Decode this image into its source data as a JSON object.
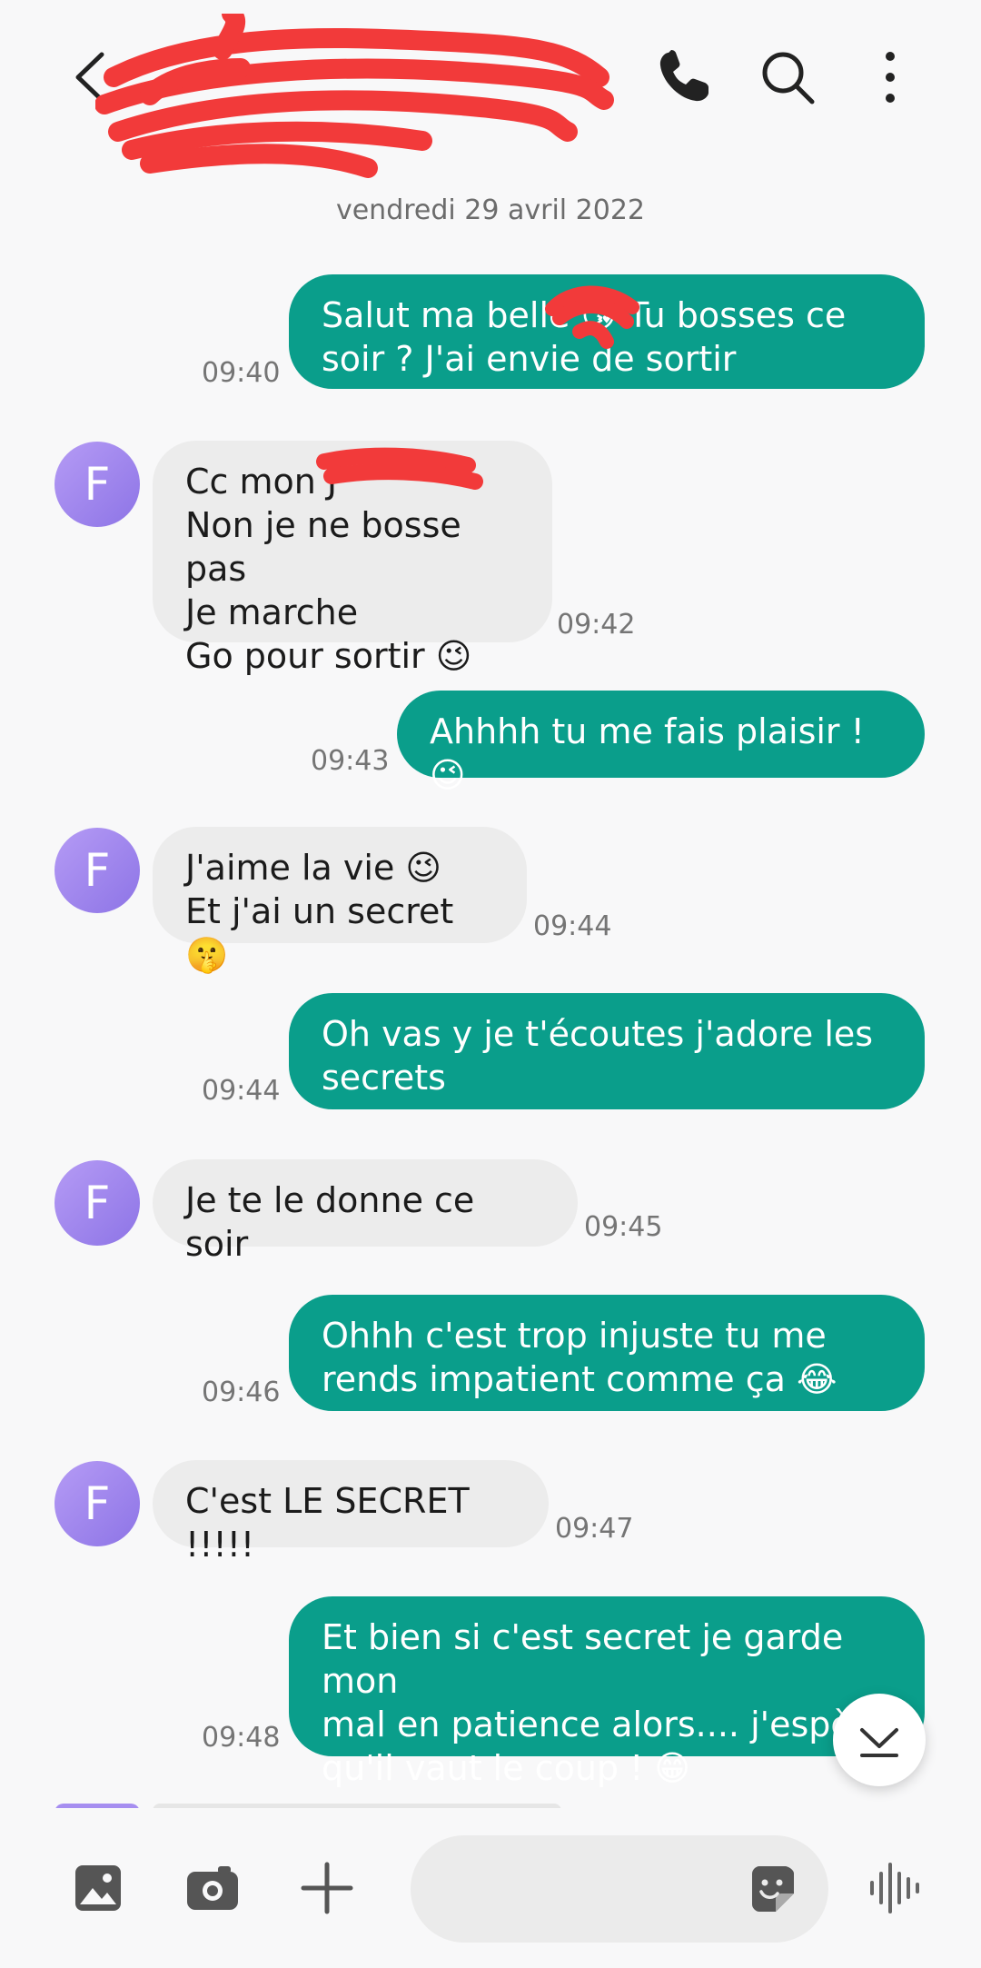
{
  "header": {
    "icons": [
      "back-icon",
      "phone-icon",
      "search-icon",
      "more-vertical-icon"
    ]
  },
  "date_label": "vendredi 29 avril 2022",
  "messages": [
    {
      "dir": "out",
      "text": "Salut ma belle 😘 Tu bosses ce\nsoir ? J'ai envie de sortir",
      "time": "09:40"
    },
    {
      "dir": "in",
      "avatar": "F",
      "text": "Cc mon J\nNon je ne bosse pas\nJe marche\nGo pour sortir 😉",
      "time": "09:42"
    },
    {
      "dir": "out",
      "text": "Ahhhh tu me fais plaisir ! 😉",
      "time": "09:43"
    },
    {
      "dir": "in",
      "avatar": "F",
      "text": "J'aime la vie 😉\nEt j'ai un secret 🤫",
      "time": "09:44"
    },
    {
      "dir": "out",
      "text": "Oh vas y je t'écoutes j'adore les\nsecrets",
      "time": "09:44"
    },
    {
      "dir": "in",
      "avatar": "F",
      "text": "Je te le donne ce soir",
      "time": "09:45"
    },
    {
      "dir": "out",
      "text": "Ohhh c'est trop injuste tu me\nrends impatient comme ça 😂",
      "time": "09:46"
    },
    {
      "dir": "in",
      "avatar": "F",
      "text": "C'est LE SECRET !!!!!",
      "time": "09:47"
    },
    {
      "dir": "out",
      "text": "Et bien si c'est secret je garde mon\nmal en patience alors.... j'espère\nqu'il vaut le coup ! 😁",
      "time": "09:48"
    }
  ],
  "colors": {
    "outgoing_bubble": "#0a9e8b",
    "incoming_bubble": "#ececec",
    "avatar": "#9b83ee"
  },
  "composer": {
    "icons": [
      "image-icon",
      "camera-icon",
      "plus-icon",
      "sticker-icon",
      "voice-icon"
    ],
    "input_value": ""
  }
}
